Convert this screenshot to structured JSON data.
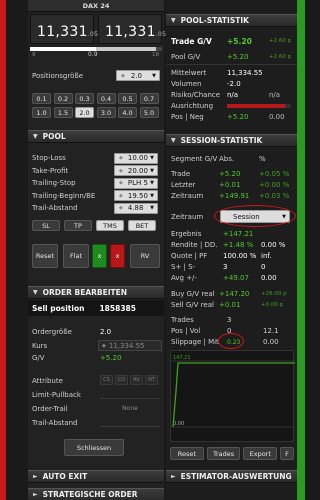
{
  "instrument": "DAX 24",
  "quote": {
    "bid_main": "11,331",
    "bid_frac": "05",
    "ask_main": "11,331",
    "ask_frac": "05",
    "spread_left": "9",
    "spread_mid": "0.9",
    "spread_right": "18"
  },
  "position_size": {
    "label": "Positionsgröße",
    "value": "2.0",
    "buttons": [
      "0.1",
      "0.2",
      "0.3",
      "0.4",
      "0.5",
      "0.7",
      "1.0",
      "1.5",
      "2.0",
      "3.0",
      "4.0",
      "5.0"
    ],
    "selected": "2.0"
  },
  "pool": {
    "title": "POOL",
    "rows": [
      {
        "label": "Stop-Loss",
        "value": "10.00"
      },
      {
        "label": "Take-Profit",
        "value": "20.00"
      },
      {
        "label": "Trailing-Stop",
        "value": "PLH 5"
      },
      {
        "label": "Trailing-Beginn/BE",
        "value": "19.50"
      },
      {
        "label": "Trail-Abstand",
        "value": "4.88"
      }
    ],
    "mode_buttons": [
      "SL",
      "TP",
      "TMS",
      "BET"
    ],
    "actions": {
      "reset": "Reset",
      "flat": "Flat",
      "x1": "x",
      "x2": "x",
      "rv": "RV"
    }
  },
  "order": {
    "title": "ORDER BEARBEITEN",
    "position_label": "Sell position",
    "position_id": "1858385",
    "ordergroesse_label": "Ordergröße",
    "ordergroesse": "2.0",
    "kurs_label": "Kurs",
    "kurs": "11,334.55",
    "gv_label": "G/V",
    "gv": "+5.20",
    "attribute_label": "Attribute",
    "attribute_tags": [
      "CS",
      "CO",
      "RV",
      "NT"
    ],
    "limit_pullback_label": "Limit-Pullback",
    "order_trail_label": "Order-Trail",
    "order_trail_value": "None",
    "trail_abstand_label": "Trail-Abstand",
    "close_button": "Schliessen"
  },
  "bottom_sections": {
    "auto_exit": "AUTO EXIT",
    "strategische_order": "STRATEGISCHE ORDER",
    "estimator": "ESTIMATOR-AUSWERTUNG"
  },
  "pool_statistik": {
    "title": "POOL-STATISTIK",
    "trade_gv_label": "Trade G/V",
    "trade_gv": "+5.20",
    "trade_gv_pts": "+2.60 p",
    "pool_gv_label": "Pool G/V",
    "pool_gv": "+5.20",
    "pool_gv_pts": "+2.60 p",
    "rows": [
      {
        "label": "Mittelwert",
        "value": "11,334.55"
      },
      {
        "label": "Volumen",
        "value": "-2.0"
      },
      {
        "label": "Risiko/Chance",
        "value": "n/a",
        "value2": "n/a"
      },
      {
        "label": "Ausrichtung",
        "value": ""
      },
      {
        "label": "Pos | Neg",
        "value": "+5.20",
        "value2": "0.00"
      }
    ]
  },
  "session_statistik": {
    "title": "SESSION-STATISTIK",
    "col_header_label": "Segment G/V",
    "col_abs": "Abs.",
    "col_pct": "%",
    "rows": [
      {
        "label": "Trade",
        "abs": "+5.20",
        "pct": "+0.05 %"
      },
      {
        "label": "Letzter",
        "abs": "+0.01",
        "pct": "+0.00 %"
      },
      {
        "label": "Zeitraum",
        "abs": "+149.91",
        "pct": "+0.03 %"
      }
    ],
    "zeitraum_label": "Zeitraum",
    "zeitraum_value": "Session",
    "rows2": [
      {
        "label": "Ergebnis",
        "value": "+147.21",
        "value2": ""
      },
      {
        "label": "Rendite | DD.",
        "value": "+1.48 %",
        "value2": "0.00 %"
      },
      {
        "label": "Quote | PF",
        "value": "100.00 %",
        "value2": "inf."
      },
      {
        "label": "S+ | S-",
        "value": "3",
        "value2": "0"
      },
      {
        "label": "Avg +/-",
        "value": "+49.07",
        "value2": "0.00"
      }
    ],
    "buy_gv_label": "Buy G/V real",
    "buy_gv": "+147.20",
    "buy_gv_pts": "+26.00 p",
    "sell_gv_label": "Sell G/V real",
    "sell_gv": "+0.01",
    "sell_gv_pts": "+0.00 p",
    "trades_label": "Trades",
    "trades": "3",
    "pos_vol_label": "Pos | Vol",
    "pos_vol": "0",
    "pos_vol2": "12.1",
    "slippage_label": "Slippage | Mit",
    "slippage": "0.23",
    "slippage2": "0.00",
    "chart_top_label": "147.21",
    "chart_bottom_label": "0.00",
    "footer_buttons": [
      "Reset",
      "Trades",
      "Export",
      "F"
    ]
  }
}
